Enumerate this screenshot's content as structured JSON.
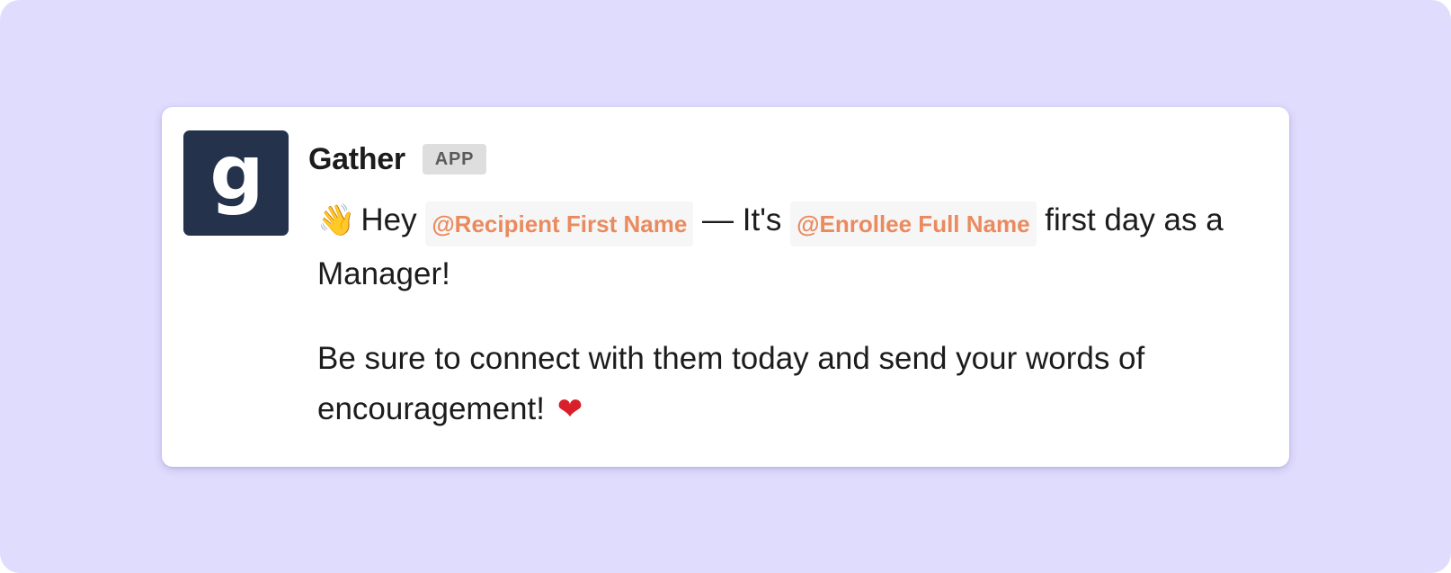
{
  "message": {
    "sender": {
      "avatar_letter": "g",
      "name": "Gather",
      "badge": "APP"
    },
    "line1": {
      "wave_icon": "👋",
      "greeting": "Hey",
      "mention_recipient": "@Recipient First Name",
      "dash_text": "— It's",
      "mention_enrollee": "@Enrollee Full Name",
      "tail": "first day as a Manager!"
    },
    "line2": {
      "text": "Be sure to connect with them today and send your words of encouragement!",
      "heart_icon": "❤"
    }
  },
  "colors": {
    "background": "#e0dcfe",
    "card": "#ffffff",
    "avatar": "#24334b",
    "mention_text": "#ea8a5e",
    "mention_bg": "#f6f6f6",
    "badge_bg": "#dedede",
    "heart": "#d9202a"
  }
}
